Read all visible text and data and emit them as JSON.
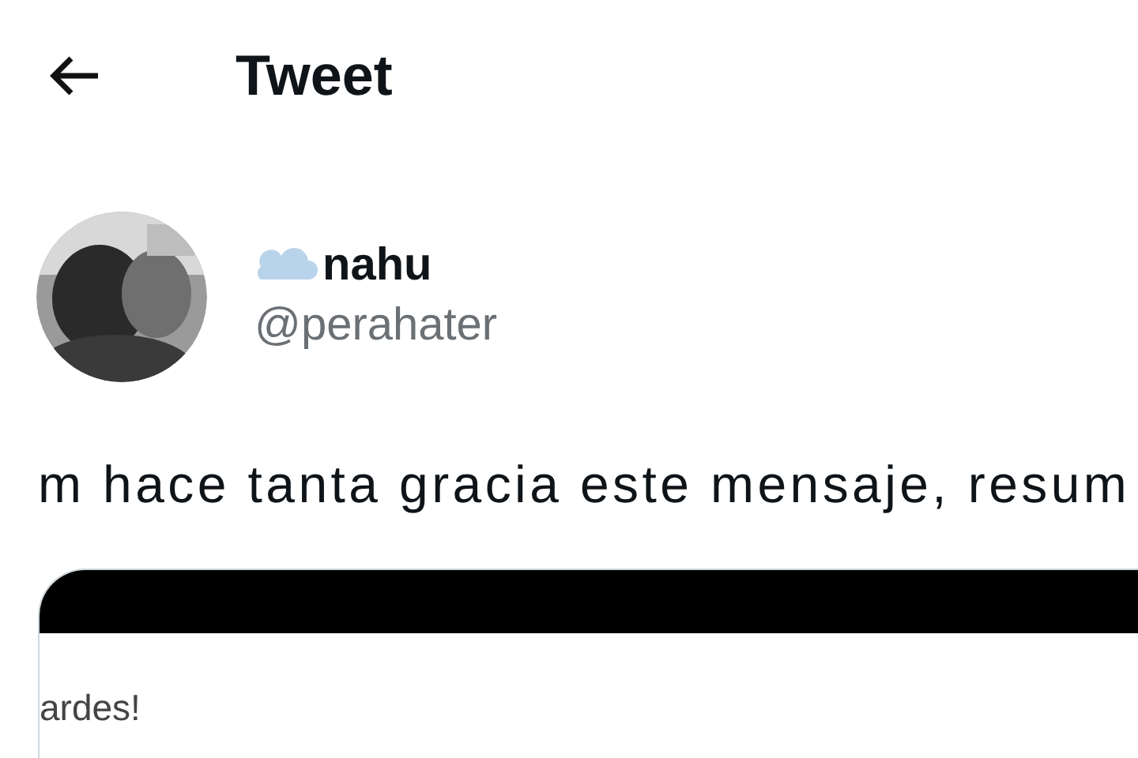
{
  "header": {
    "title": "Tweet"
  },
  "author": {
    "name": "nahu",
    "handle": "@perahater"
  },
  "tweet": {
    "text": "m hace tanta gracia este mensaje, resum"
  },
  "attached_image": {
    "text": "ardes!"
  }
}
